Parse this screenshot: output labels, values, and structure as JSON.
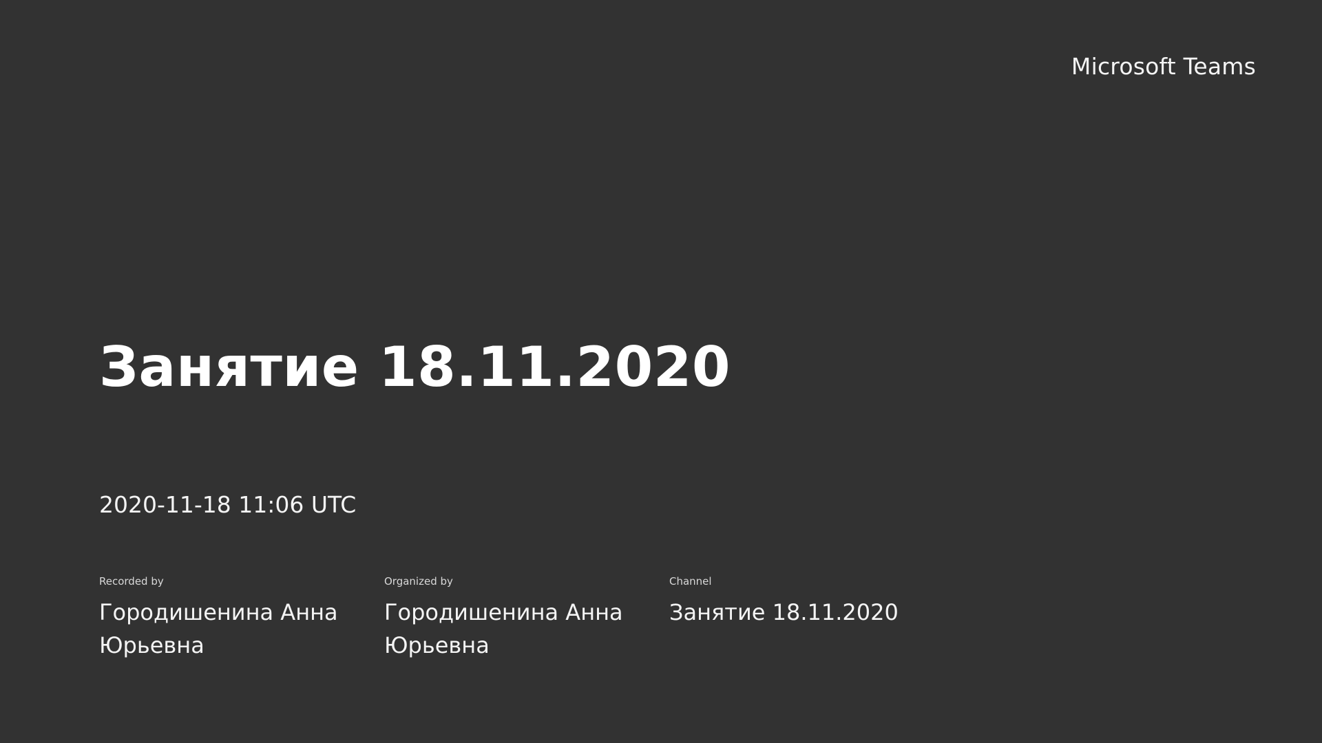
{
  "app": {
    "name": "Microsoft Teams"
  },
  "recording": {
    "title": "Занятие 18.11.2020",
    "timestamp": "2020-11-18 11:06 UTC",
    "recorded_by": {
      "label": "Recorded by",
      "value": "Городишенина Анна Юрьевна"
    },
    "organized_by": {
      "label": "Organized by",
      "value": "Городишенина Анна Юрьевна"
    },
    "channel": {
      "label": "Channel",
      "value": "Занятие 18.11.2020"
    }
  },
  "colors": {
    "background": "#323232",
    "text": "#ffffff"
  }
}
